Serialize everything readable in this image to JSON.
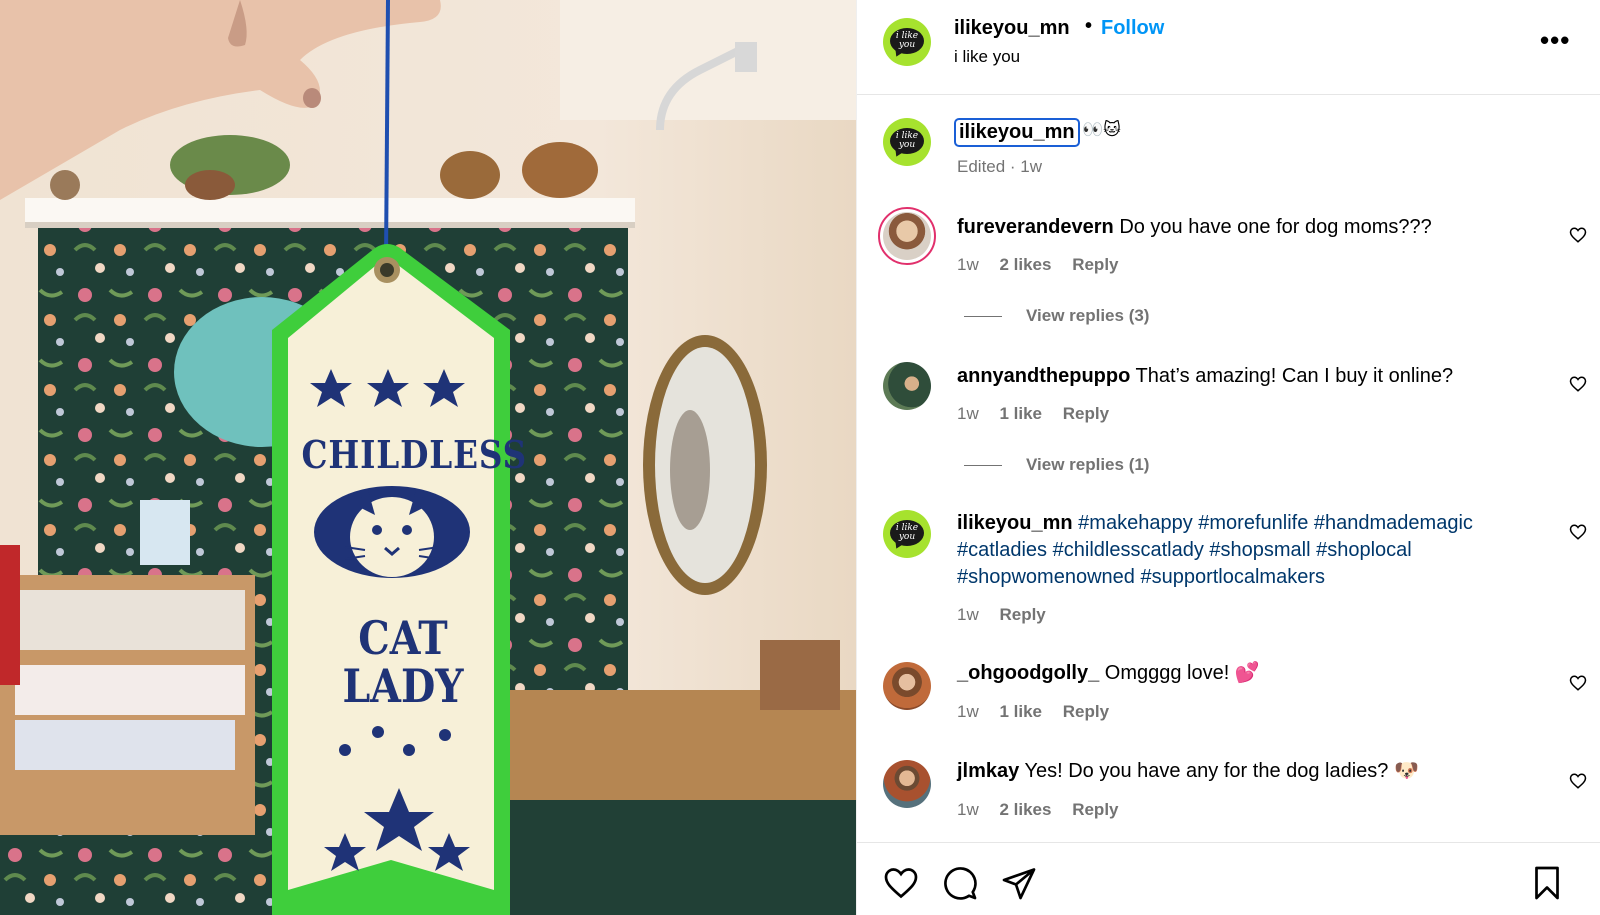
{
  "photo": {
    "ribbon_line1": "CHILDLESS",
    "ribbon_line2": "CAT",
    "ribbon_line3": "LADY"
  },
  "header": {
    "username": "ilikeyou_mn",
    "separator": "•",
    "follow_label": "Follow",
    "subtitle": "i like you",
    "more_label": "•••",
    "avatar_text": "i like you"
  },
  "caption": {
    "username": "ilikeyou_mn",
    "emoji": "👀🐱",
    "meta": "Edited · 1w"
  },
  "comments": [
    {
      "username": "fureverandevern",
      "text": "Do you have one for dog moms???",
      "time": "1w",
      "likes": "2 likes",
      "reply_label": "Reply",
      "view_replies": "View replies (3)"
    },
    {
      "username": "annyandthepuppo",
      "text": "That’s amazing! Can I buy it online?",
      "time": "1w",
      "likes": "1 like",
      "reply_label": "Reply",
      "view_replies": "View replies (1)"
    },
    {
      "username": "ilikeyou_mn",
      "hashtags": [
        "#makehappy",
        "#morefunlife",
        "#handmademagic",
        "#catladies",
        "#childlesscatlady",
        "#shopsmall",
        "#shoplocal",
        "#shopwomenowned",
        "#supportlocalmakers"
      ],
      "time": "1w",
      "reply_label": "Reply"
    },
    {
      "username": "_ohgoodgolly_",
      "text": "Omgggg love! 💕",
      "time": "1w",
      "likes": "1 like",
      "reply_label": "Reply"
    },
    {
      "username": "jlmkay",
      "text": "Yes! Do you have any for the dog ladies? 🐶",
      "time": "1w",
      "likes": "2 likes",
      "reply_label": "Reply"
    }
  ],
  "colors": {
    "follow": "#0095f6",
    "hashtag": "#00376b",
    "meta": "#737373",
    "avatar_green": "#a6e22e",
    "ribbon_green": "#3fce3c",
    "ribbon_navy": "#1f3377"
  },
  "icons": [
    "heart-icon",
    "comment-icon",
    "share-icon",
    "bookmark-icon",
    "more-icon"
  ]
}
